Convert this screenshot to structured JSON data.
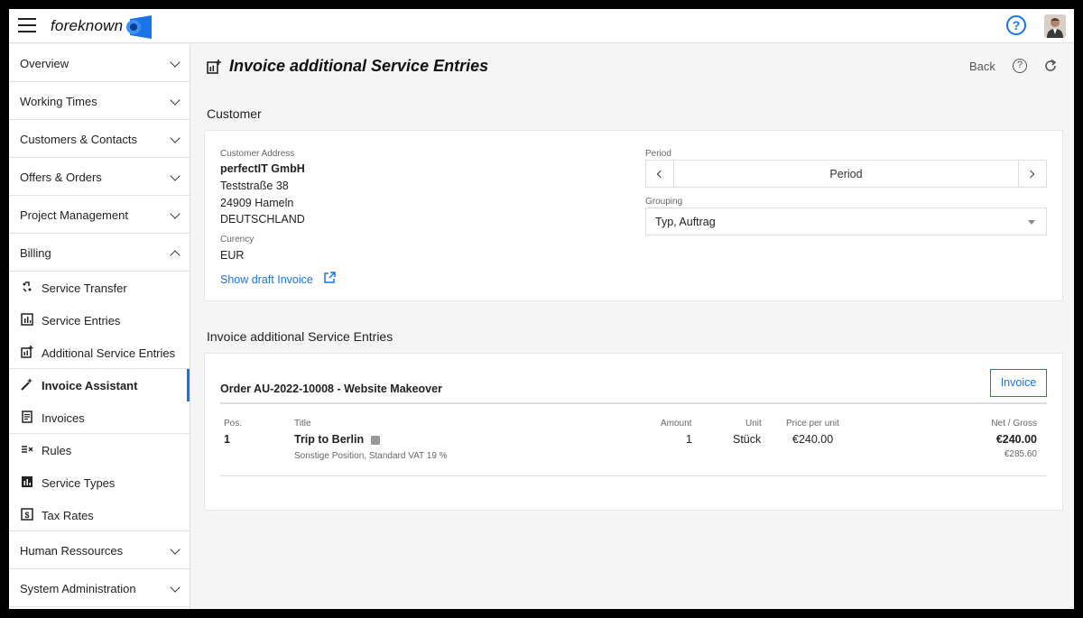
{
  "app": {
    "logo_text": "foreknown"
  },
  "sidebar": {
    "groups_top": [
      {
        "label": "Overview"
      },
      {
        "label": "Working Times"
      },
      {
        "label": "Customers & Contacts"
      },
      {
        "label": "Offers & Orders"
      },
      {
        "label": "Project Management"
      },
      {
        "label": "Billing"
      }
    ],
    "billing_items": [
      {
        "label": "Service Transfer",
        "icon": "service-transfer-icon"
      },
      {
        "label": "Service Entries",
        "icon": "service-entries-icon"
      },
      {
        "label": "Additional Service Entries",
        "icon": "additional-service-entries-icon"
      },
      {
        "label": "Invoice Assistant",
        "icon": "magic-wand-icon",
        "active": true
      },
      {
        "label": "Invoices",
        "icon": "invoices-icon"
      },
      {
        "label": "Rules",
        "icon": "rules-icon"
      },
      {
        "label": "Service Types",
        "icon": "service-types-icon"
      },
      {
        "label": "Tax Rates",
        "icon": "tax-rates-icon"
      }
    ],
    "groups_bottom": [
      {
        "label": "Human Ressources"
      },
      {
        "label": "System Administration"
      }
    ]
  },
  "header": {
    "title": "Invoice additional Service Entries",
    "back_label": "Back"
  },
  "customer_section": {
    "title": "Customer",
    "address_label": "Customer Address",
    "company": "perfectIT GmbH",
    "street": "Teststraße 38",
    "city": "24909 Hameln",
    "country": "DEUTSCHLAND",
    "currency_label": "Curency",
    "currency": "EUR",
    "draft_link": "Show draft Invoice",
    "period_label": "Period",
    "period_value": "Period",
    "grouping_label": "Grouping",
    "grouping_value": "Typ, Auftrag"
  },
  "entries_section": {
    "title": "Invoice additional Service Entries",
    "order_title": "Order AU-2022-10008 - Website Makeover",
    "invoice_button": "Invoice",
    "columns": {
      "pos": "Pos.",
      "title": "Title",
      "amount": "Amount",
      "unit": "Unit",
      "price": "Price per unit",
      "net_gross": "Net / Gross"
    },
    "rows": [
      {
        "pos": "1",
        "title": "Trip to Berlin",
        "subtitle": "Sonstige Position, Standard VAT 19 %",
        "amount": "1",
        "unit": "Stück",
        "price": "€240.00",
        "net": "€240.00",
        "gross": "€285.60"
      }
    ]
  },
  "colors": {
    "accent": "#1a73e8",
    "background": "#f5f5f5"
  }
}
